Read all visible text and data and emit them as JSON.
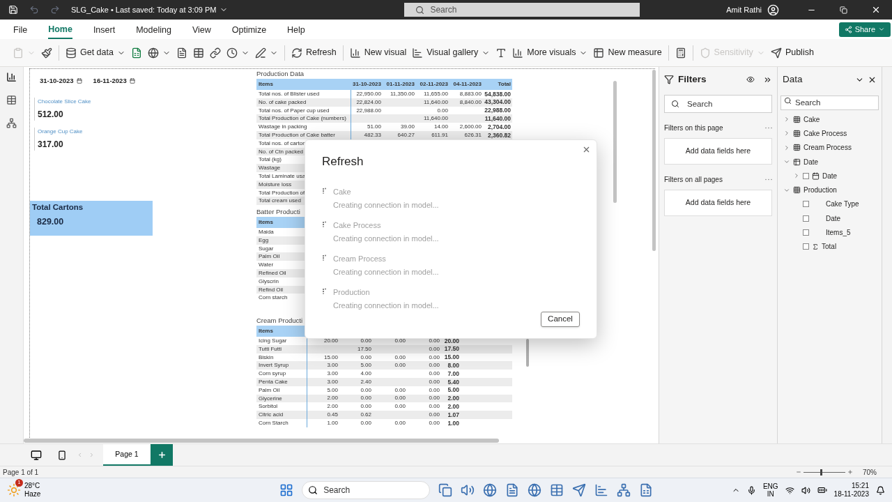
{
  "title_bar": {
    "file_name": "SLG_Cake",
    "separator": "•",
    "saved": "Last saved: Today at 3:09 PM",
    "search_placeholder": "Search",
    "user": "Amit Rathi"
  },
  "menu_tabs": [
    {
      "label": "File",
      "selected": false
    },
    {
      "label": "Home",
      "selected": true
    },
    {
      "label": "Insert",
      "selected": false
    },
    {
      "label": "Modeling",
      "selected": false
    },
    {
      "label": "View",
      "selected": false
    },
    {
      "label": "Optimize",
      "selected": false
    },
    {
      "label": "Help",
      "selected": false
    }
  ],
  "share": "Share",
  "ribbon": [
    {
      "dropdown": true,
      "disabled": true
    },
    {
      "dropdown": false,
      "disabled": false
    },
    {
      "label": "Get data",
      "dropdown": true,
      "disabled": false
    },
    {
      "dropdown": false,
      "disabled": false
    },
    {
      "dropdown": true,
      "disabled": false
    },
    {
      "dropdown": false,
      "disabled": false
    },
    {
      "dropdown": false,
      "disabled": false
    },
    {
      "dropdown": false,
      "disabled": false
    },
    {
      "dropdown": true,
      "disabled": false
    },
    {
      "dropdown": true,
      "disabled": false
    },
    {
      "label": "Refresh",
      "dropdown": false,
      "disabled": false
    },
    {
      "label": "New visual",
      "dropdown": false,
      "disabled": false
    },
    {
      "label": "Visual gallery",
      "dropdown": true,
      "disabled": false
    },
    {
      "dropdown": false,
      "disabled": false
    },
    {
      "label": "More visuals",
      "dropdown": true,
      "disabled": false
    },
    {
      "label": "New measure",
      "dropdown": false,
      "disabled": false
    },
    {
      "dropdown": false,
      "disabled": false
    },
    {
      "label": "Sensitivity",
      "dropdown": true,
      "disabled": true
    },
    {
      "label": "Publish",
      "dropdown": false,
      "disabled": false
    }
  ],
  "slicer": {
    "start": "31-10-2023",
    "end": "16-11-2023"
  },
  "cards": [
    {
      "label": "Chocolate Slice Cake",
      "value": "512.00"
    },
    {
      "label": "Orange Cup Cake",
      "value": "317.00"
    }
  ],
  "total_card": {
    "label": "Total Cartons",
    "value": "829.00"
  },
  "production_table": {
    "title": "Production Data",
    "columns": [
      "Items",
      "31-10-2023",
      "01-11-2023",
      "02-11-2023",
      "04-11-2023",
      "Total"
    ],
    "rows": [
      {
        "item": "Total nos. of Blister used",
        "d1": "22,950.00",
        "d2": "11,350.00",
        "d3": "11,655.00",
        "d4": "8,883.00",
        "total": "54,838.00"
      },
      {
        "item": "No. of cake packed",
        "d1": "22,824.00",
        "d3": "11,640.00",
        "d4": "8,840.00",
        "total": "43,304.00"
      },
      {
        "item": "Total nos. of Paper cup used",
        "d1": "22,988.00",
        "d3": "0.00",
        "total": "22,988.00"
      },
      {
        "item": "Total Production of Cake (numbers)",
        "d3": "11,640.00",
        "total": "11,640.00"
      },
      {
        "item": "Wastage in packing",
        "d1": "51.00",
        "d2": "39.00",
        "d3": "14.00",
        "d4": "2,600.00",
        "total": "2,704.00"
      },
      {
        "item": "Total Production of Cake batter",
        "d1": "482.33",
        "d2": "640.27",
        "d3": "611.91",
        "d4": "626.31",
        "total": "2,360.82"
      },
      {
        "item": "Total nos. of carton"
      },
      {
        "item": "No. of Ctn packed"
      },
      {
        "item": "Total (kg)"
      },
      {
        "item": "Wastage"
      },
      {
        "item": "Total Laminate usa"
      },
      {
        "item": "Moisture loss"
      },
      {
        "item": "Total Production of"
      },
      {
        "item": "Total cream used"
      }
    ]
  },
  "batter_table": {
    "title": "Batter Producti",
    "columns": [
      "Items"
    ],
    "rows": [
      {
        "item": "Maida"
      },
      {
        "item": "Egg"
      },
      {
        "item": "Sugar"
      },
      {
        "item": "Palm Oil"
      },
      {
        "item": "Water"
      },
      {
        "item": "Refined Oil"
      },
      {
        "item": "Glyscrin"
      },
      {
        "item": "Refind Oil"
      },
      {
        "item": "Corn starch"
      }
    ]
  },
  "cream_table": {
    "title": "Cream Producti",
    "columns": [
      "Items"
    ],
    "rows": [
      {
        "item": "Icing Sugar",
        "d1": "20.00",
        "d2": "0.00",
        "d3": "0.00",
        "d4": "0.00",
        "total": "20.00"
      },
      {
        "item": "Tutti Futti",
        "d2": "17.50",
        "d4": "0.00",
        "total": "17.50"
      },
      {
        "item": "Biskin",
        "d1": "15.00",
        "d2": "0.00",
        "d3": "0.00",
        "d4": "0.00",
        "total": "15.00"
      },
      {
        "item": "Invert Syrup",
        "d1": "3.00",
        "d2": "5.00",
        "d3": "0.00",
        "d4": "0.00",
        "total": "8.00"
      },
      {
        "item": "Corn syrup",
        "d1": "3.00",
        "d2": "4.00",
        "d4": "0.00",
        "total": "7.00"
      },
      {
        "item": "Penta Cake",
        "d1": "3.00",
        "d2": "2.40",
        "d4": "0.00",
        "total": "5.40"
      },
      {
        "item": "Palm Oil",
        "d1": "5.00",
        "d2": "0.00",
        "d3": "0.00",
        "d4": "0.00",
        "total": "5.00"
      },
      {
        "item": "Glycerine",
        "d1": "2.00",
        "d2": "0.00",
        "d3": "0.00",
        "d4": "0.00",
        "total": "2.00"
      },
      {
        "item": "Sorbitol",
        "d1": "2.00",
        "d2": "0.00",
        "d3": "0.00",
        "d4": "0.00",
        "total": "2.00"
      },
      {
        "item": "Citric acid",
        "d1": "0.45",
        "d2": "0.62",
        "d4": "0.00",
        "total": "1.07"
      },
      {
        "item": "Corn Starch",
        "d1": "1.00",
        "d2": "0.00",
        "d3": "0.00",
        "d4": "0.00",
        "total": "1.00"
      }
    ]
  },
  "dialog": {
    "title": "Refresh",
    "tasks": [
      {
        "name": "Cake",
        "status": "Creating connection in model..."
      },
      {
        "name": "Cake Process",
        "status": "Creating connection in model..."
      },
      {
        "name": "Cream Process",
        "status": "Creating connection in model..."
      },
      {
        "name": "Production",
        "status": "Creating connection in model..."
      }
    ],
    "button": "Cancel"
  },
  "filters": {
    "title": "Filters",
    "search_placeholder": "Search",
    "sections": [
      {
        "title": "Filters on this page",
        "drop": "Add data fields here"
      },
      {
        "title": "Filters on all pages",
        "drop": "Add data fields here"
      }
    ]
  },
  "data_pane": {
    "title": "Data",
    "search_placeholder": "Search",
    "tree": [
      {
        "label": "Cake",
        "kind": "table",
        "expanded": false
      },
      {
        "label": "Cake Process",
        "kind": "table",
        "expanded": false
      },
      {
        "label": "Cream Process",
        "kind": "table",
        "expanded": false
      },
      {
        "label": "Date",
        "kind": "date_table",
        "expanded": true,
        "children": [
          {
            "label": "Date",
            "kind": "hierarchy",
            "expanded": false,
            "checked": false
          }
        ]
      },
      {
        "label": "Production",
        "kind": "table",
        "expanded": true,
        "children": [
          {
            "label": "Cake Type",
            "kind": "field",
            "checked": false
          },
          {
            "label": "Date",
            "kind": "field",
            "checked": false
          },
          {
            "label": "Items_5",
            "kind": "field",
            "checked": false
          },
          {
            "label": "Total",
            "kind": "measure",
            "checked": false
          }
        ]
      }
    ]
  },
  "page_tabs": [
    {
      "label": "Page 1",
      "selected": true
    }
  ],
  "status": "Page 1 of 1",
  "zoom": {
    "level": 0.4,
    "reading": "70%"
  },
  "taskbar": {
    "temp": "28°C",
    "condition": "Haze",
    "badge": "1",
    "search_placeholder": "Search",
    "lang": "ENG",
    "region": "IN",
    "time": "15:21",
    "date": "18-11-2023"
  }
}
